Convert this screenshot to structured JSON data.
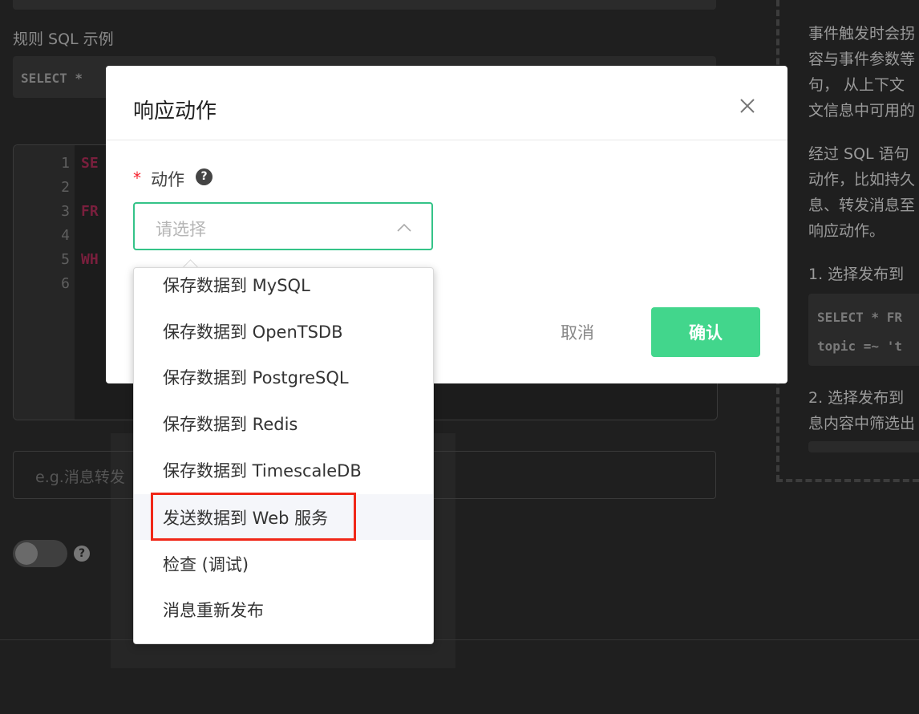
{
  "background": {
    "rule_sql_label": "规则 SQL 示例",
    "sample_sql": "SELECT *",
    "editor_lines": [
      "1",
      "2",
      "3",
      "4",
      "5",
      "6"
    ],
    "editor_keywords": [
      "SE",
      "FR",
      "WH"
    ],
    "description_placeholder": "e.g.消息转发",
    "help_paragraph1": [
      "事件触发时会拐",
      "容与事件参数等",
      "句， 从上下文",
      "文信息中可用的"
    ],
    "help_paragraph2": [
      "经过 SQL 语句",
      "动作，比如持久",
      "息、转发消息至",
      "响应动作。"
    ],
    "help_item1": "1. 选择发布到",
    "help_code": [
      "SELECT * FR",
      "topic =~ 't"
    ],
    "help_item2": [
      "2. 选择发布到",
      "息内容中筛选出"
    ]
  },
  "modal": {
    "title": "响应动作",
    "field_required_mark": "*",
    "field_label": "动作",
    "info_symbol": "?",
    "select_placeholder": "请选择",
    "cancel_label": "取消",
    "confirm_label": "确认"
  },
  "dropdown": {
    "options": [
      "保存数据到 MySQL",
      "保存数据到 OpenTSDB",
      "保存数据到 PostgreSQL",
      "保存数据到 Redis",
      "保存数据到 TimescaleDB",
      "发送数据到 Web 服务",
      "检查 (调试)",
      "消息重新发布"
    ],
    "hovered_option": "发送数据到 Web 服务",
    "highlighted_option": "发送数据到 Web 服务"
  },
  "colors": {
    "accent_green": "#42d68c",
    "select_border": "#34c388",
    "required_red": "#f5222d",
    "highlight_red": "#f02718"
  },
  "icons": [
    "close-icon",
    "chevron-up-icon",
    "question-icon"
  ]
}
